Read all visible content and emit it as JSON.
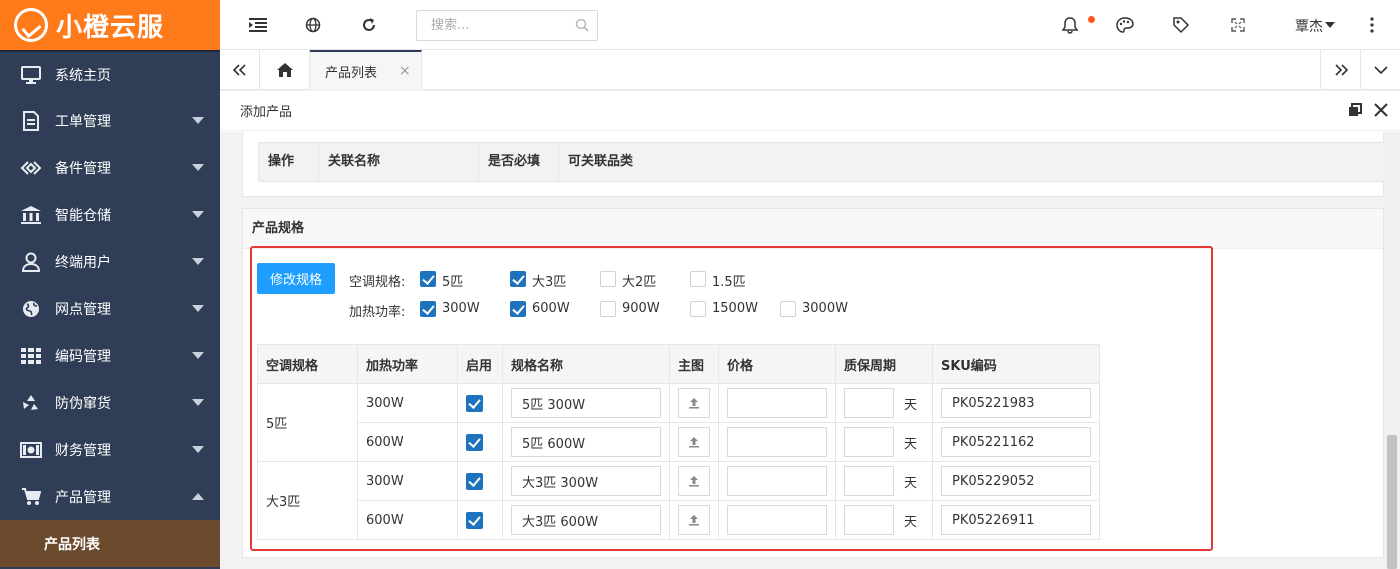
{
  "app": {
    "logo_text": "小橙云服"
  },
  "sidebar": {
    "items": [
      {
        "label": "系统主页",
        "icon": "monitor-icon",
        "has_caret": false
      },
      {
        "label": "工单管理",
        "icon": "document-icon",
        "has_caret": true
      },
      {
        "label": "备件管理",
        "icon": "diamond-icon",
        "has_caret": true
      },
      {
        "label": "智能仓储",
        "icon": "bank-icon",
        "has_caret": true
      },
      {
        "label": "终端用户",
        "icon": "user-icon",
        "has_caret": true
      },
      {
        "label": "网点管理",
        "icon": "globe-icon",
        "has_caret": true
      },
      {
        "label": "编码管理",
        "icon": "grid-icon",
        "has_caret": true
      },
      {
        "label": "防伪窜货",
        "icon": "recycle-icon",
        "has_caret": true
      },
      {
        "label": "财务管理",
        "icon": "money-icon",
        "has_caret": true
      },
      {
        "label": "产品管理",
        "icon": "cart-icon",
        "has_caret": true,
        "expanded": true
      }
    ],
    "subitems": [
      {
        "label": "产品列表",
        "active": true
      }
    ]
  },
  "topbar": {
    "search_placeholder": "搜索...",
    "username": "覃杰"
  },
  "tabs": {
    "active_label": "产品列表",
    "close_glyph": "×"
  },
  "panel": {
    "title": "添加产品"
  },
  "relation_table": {
    "headers": [
      "操作",
      "关联名称",
      "是否必填",
      "可关联品类"
    ]
  },
  "spec_section": {
    "title": "产品规格",
    "modify_button": "修改规格",
    "groups": [
      {
        "label": "空调规格:",
        "options": [
          {
            "label": "5匹",
            "checked": true
          },
          {
            "label": "大3匹",
            "checked": true
          },
          {
            "label": "大2匹",
            "checked": false
          },
          {
            "label": "1.5匹",
            "checked": false
          }
        ]
      },
      {
        "label": "加热功率:",
        "options": [
          {
            "label": "300W",
            "checked": true
          },
          {
            "label": "600W",
            "checked": true
          },
          {
            "label": "900W",
            "checked": false
          },
          {
            "label": "1500W",
            "checked": false
          },
          {
            "label": "3000W",
            "checked": false
          }
        ]
      }
    ]
  },
  "sku_table": {
    "headers": [
      "空调规格",
      "加热功率",
      "启用",
      "规格名称",
      "主图",
      "价格",
      "质保周期",
      "SKU编码"
    ],
    "day_unit": "天",
    "groups": [
      {
        "spec": "5匹",
        "rows": [
          {
            "power": "300W",
            "enabled": true,
            "name": "5匹 300W",
            "price": "",
            "warranty": "",
            "sku": "PK05221983"
          },
          {
            "power": "600W",
            "enabled": true,
            "name": "5匹 600W",
            "price": "",
            "warranty": "",
            "sku": "PK05221162"
          }
        ]
      },
      {
        "spec": "大3匹",
        "rows": [
          {
            "power": "300W",
            "enabled": true,
            "name": "大3匹 300W",
            "price": "",
            "warranty": "",
            "sku": "PK05229052"
          },
          {
            "power": "600W",
            "enabled": true,
            "name": "大3匹 600W",
            "price": "",
            "warranty": "",
            "sku": "PK05226911"
          }
        ]
      }
    ]
  },
  "colors": {
    "brand": "#ff7a1a",
    "sidebar_bg": "#2f3e56",
    "primary_button": "#1e9fff",
    "checkbox_on": "#1e73be",
    "highlight_border": "#e53935"
  }
}
